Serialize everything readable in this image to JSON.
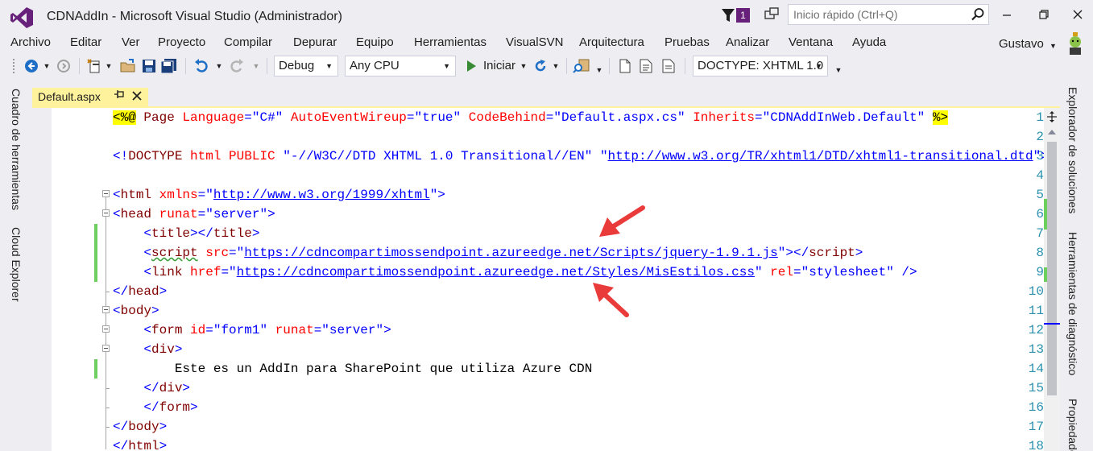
{
  "window": {
    "title": "CDNAddIn - Microsoft Visual Studio (Administrador)",
    "notification_count": "1",
    "quick_launch_placeholder": "Inicio rápido (Ctrl+Q)",
    "user": "Gustavo",
    "accent_color": "#68217a"
  },
  "menu": [
    "Archivo",
    "Editar",
    "Ver",
    "Proyecto",
    "Compilar",
    "Depurar",
    "Equipo",
    "Herramientas",
    "VisualSVN",
    "Arquitectura",
    "Pruebas",
    "Analizar",
    "Ventana",
    "Ayuda"
  ],
  "toolbar": {
    "configuration": "Debug",
    "platform": "Any CPU",
    "start_label": "Iniciar",
    "doctype": "DOCTYPE: XHTML 1.0"
  },
  "left_dock": [
    "Cuadro de herramientas",
    "Cloud Explorer"
  ],
  "right_dock": [
    "Explorador de soluciones",
    "Herramientas de diagnóstico",
    "Propiedades"
  ],
  "document_tab": {
    "label": "Default.aspx",
    "tab_color": "#fff29d"
  },
  "editor": {
    "line_numbers": [
      "1",
      "2",
      "3",
      "4",
      "5",
      "6",
      "7",
      "8",
      "9",
      "10",
      "11",
      "12",
      "13",
      "14",
      "15",
      "16",
      "17",
      "18"
    ],
    "line1": {
      "open": "<%@",
      "directive": "Page",
      "a1": "Language",
      "v1": "\"C#\"",
      "a2": "AutoEventWireup",
      "v2": "\"true\"",
      "a3": "CodeBehind",
      "v3": "\"Default.aspx.cs\"",
      "a4": "Inherits",
      "v4": "\"CDNAddInWeb.Default\"",
      "close": "%>"
    },
    "line3": {
      "open": "<!",
      "doctype": "DOCTYPE",
      "html": "html",
      "public": "PUBLIC",
      "fpi": "\"-//W3C//DTD XHTML 1.0 Transitional//EN\"",
      "url": "http://www.w3.org/TR/xhtml1/DTD/xhtml1-transitional.dtd"
    },
    "line5": {
      "tag": "html",
      "attr": "xmlns",
      "url": "http://www.w3.org/1999/xhtml"
    },
    "line6": {
      "tag": "head",
      "attr": "runat",
      "val": "\"server\""
    },
    "line7": {
      "tag": "title",
      "close": "title"
    },
    "line8": {
      "tag": "script",
      "attr": "src",
      "url": "https://cdncompartimossendpoint.azureedge.net/Scripts/jquery-1.9.1.js"
    },
    "line9": {
      "tag": "link",
      "attr": "href",
      "url": "https://cdncompartimossendpoint.azureedge.net/Styles/MisEstilos.css",
      "attr2": "rel",
      "val2": "\"stylesheet\""
    },
    "line10": {
      "tag": "head"
    },
    "line11": {
      "tag": "body"
    },
    "line12": {
      "tag": "form",
      "attr": "id",
      "val": "\"form1\"",
      "attr2": "runat",
      "val2": "\"server\""
    },
    "line13": {
      "tag": "div"
    },
    "line14": {
      "text": "Este es un AddIn para SharePoint que utiliza Azure CDN"
    },
    "line15": {
      "tag": "div"
    },
    "line16": {
      "tag": "form"
    },
    "line17": {
      "tag": "body"
    },
    "line18": {
      "tag": "html"
    }
  }
}
